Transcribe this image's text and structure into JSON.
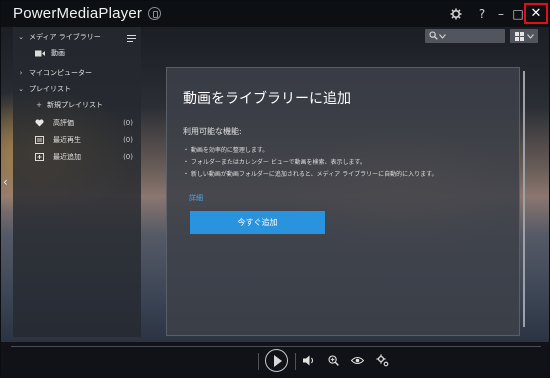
{
  "window": {
    "title": "PowerMediaPlayer"
  },
  "titlebar": {
    "settings_icon": "gear-icon",
    "help_label": "?",
    "minimize_label": "–",
    "maximize_label": "□",
    "close_label": "✕"
  },
  "sidebar": {
    "media_library": {
      "label": "メディア ライブラリー",
      "expanded": true
    },
    "videos": {
      "label": "動画"
    },
    "my_computer": {
      "label": "マイコンピューター",
      "expanded": false
    },
    "playlists": {
      "label": "プレイリスト",
      "expanded": true
    },
    "new_playlist": {
      "label": "新規プレイリスト"
    },
    "favorites": {
      "label": "高評価",
      "count": "(0)"
    },
    "recent": {
      "label": "最近再生",
      "count": "(0)"
    },
    "recently_added": {
      "label": "最近追加",
      "count": "(0)"
    }
  },
  "card": {
    "title": "動画をライブラリーに追加",
    "features_heading": "利用可能な機能:",
    "features": [
      "・ 動画を効率的に整理します。",
      "・ フォルダーまたはカレンダー ビューで動画を検索、表示します。",
      "・ 新しい動画が動画フォルダーに追加されると、メディア ライブラリーに自動的に入ります。"
    ],
    "details_link": "詳細",
    "add_button": "今すぐ追加"
  },
  "colors": {
    "accent": "#2a93de",
    "link": "#4aa8e6",
    "close_highlight": "#e0101a"
  }
}
